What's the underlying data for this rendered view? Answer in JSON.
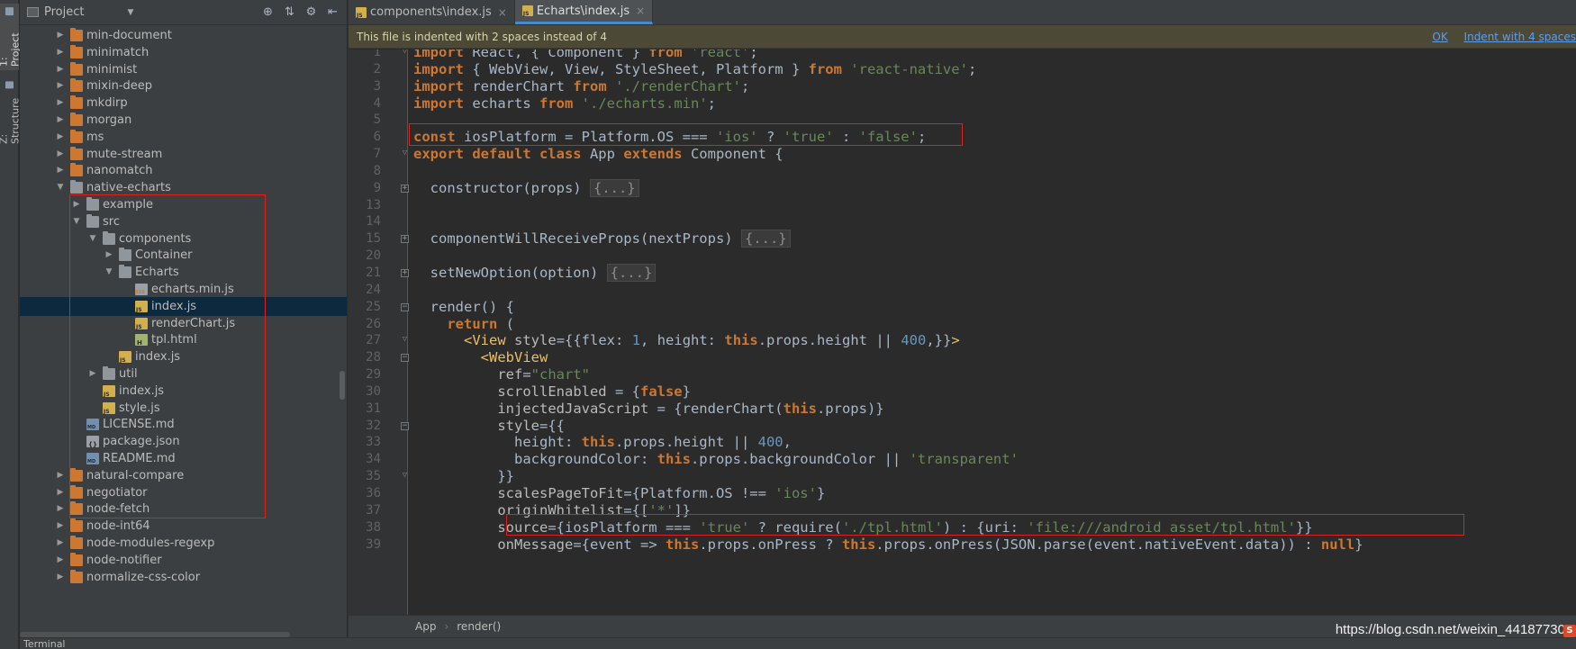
{
  "strip": {
    "project_tab": "1: Project",
    "structure_tab": "Z: Structure"
  },
  "project_panel": {
    "title": "Project",
    "tree": [
      {
        "label": "min-document",
        "type": "folder-orange",
        "level": 0,
        "expanded": false
      },
      {
        "label": "minimatch",
        "type": "folder-orange",
        "level": 0,
        "expanded": false
      },
      {
        "label": "minimist",
        "type": "folder-orange",
        "level": 0,
        "expanded": false
      },
      {
        "label": "mixin-deep",
        "type": "folder-orange",
        "level": 0,
        "expanded": false
      },
      {
        "label": "mkdirp",
        "type": "folder-orange",
        "level": 0,
        "expanded": false
      },
      {
        "label": "morgan",
        "type": "folder-orange",
        "level": 0,
        "expanded": false
      },
      {
        "label": "ms",
        "type": "folder-orange",
        "level": 0,
        "expanded": false
      },
      {
        "label": "mute-stream",
        "type": "folder-orange",
        "level": 0,
        "expanded": false
      },
      {
        "label": "nanomatch",
        "type": "folder-orange",
        "level": 0,
        "expanded": false
      },
      {
        "label": "native-echarts",
        "type": "folder-grey",
        "level": 0,
        "expanded": true
      },
      {
        "label": "example",
        "type": "folder-grey",
        "level": 1,
        "expanded": false
      },
      {
        "label": "src",
        "type": "folder-grey",
        "level": 1,
        "expanded": true
      },
      {
        "label": "components",
        "type": "folder-grey",
        "level": 2,
        "expanded": true
      },
      {
        "label": "Container",
        "type": "folder-grey",
        "level": 3,
        "expanded": false
      },
      {
        "label": "Echarts",
        "type": "folder-grey",
        "level": 3,
        "expanded": true
      },
      {
        "label": "echarts.min.js",
        "type": "file-min",
        "level": 4
      },
      {
        "label": "index.js",
        "type": "file-js",
        "level": 4,
        "selected": true
      },
      {
        "label": "renderChart.js",
        "type": "file-js",
        "level": 4
      },
      {
        "label": "tpl.html",
        "type": "file-html",
        "level": 4
      },
      {
        "label": "index.js",
        "type": "file-js",
        "level": 3
      },
      {
        "label": "util",
        "type": "folder-grey",
        "level": 2,
        "expanded": false
      },
      {
        "label": "index.js",
        "type": "file-js",
        "level": 2
      },
      {
        "label": "style.js",
        "type": "file-js",
        "level": 2
      },
      {
        "label": "LICENSE.md",
        "type": "file-md",
        "level": 1
      },
      {
        "label": "package.json",
        "type": "file-json",
        "level": 1
      },
      {
        "label": "README.md",
        "type": "file-md",
        "level": 1
      },
      {
        "label": "natural-compare",
        "type": "folder-orange",
        "level": 0,
        "expanded": false
      },
      {
        "label": "negotiator",
        "type": "folder-orange",
        "level": 0,
        "expanded": false
      },
      {
        "label": "node-fetch",
        "type": "folder-orange",
        "level": 0,
        "expanded": false
      },
      {
        "label": "node-int64",
        "type": "folder-orange",
        "level": 0,
        "expanded": false
      },
      {
        "label": "node-modules-regexp",
        "type": "folder-orange",
        "level": 0,
        "expanded": false
      },
      {
        "label": "node-notifier",
        "type": "folder-orange",
        "level": 0,
        "expanded": false
      },
      {
        "label": "normalize-css-color",
        "type": "folder-orange",
        "level": 0,
        "expanded": false
      }
    ]
  },
  "bottom_bar": {
    "label": "Terminal"
  },
  "editor": {
    "tabs": [
      {
        "label": "components\\index.js",
        "active": false
      },
      {
        "label": "Echarts\\index.js",
        "active": true
      }
    ],
    "banner": {
      "message": "This file is indented with 2 spaces instead of 4",
      "ok": "OK",
      "indent": "Indent with 4 spaces"
    },
    "line_numbers": [
      "1",
      "2",
      "3",
      "4",
      "5",
      "6",
      "7",
      "8",
      "9",
      "13",
      "14",
      "15",
      "20",
      "21",
      "24",
      "25",
      "26",
      "27",
      "28",
      "29",
      "30",
      "31",
      "32",
      "33",
      "34",
      "35",
      "36",
      "37",
      "38",
      "39"
    ],
    "breadcrumb": [
      "App",
      "render()"
    ]
  },
  "watermark": "https://blog.csdn.net/weixin_44187730",
  "colors": {
    "keyword": "#cc7832",
    "string": "#6a8759",
    "number": "#6897bb",
    "jsx_tag": "#e8bf6a",
    "highlight_box": "#e02020",
    "selection": "#0d293e"
  }
}
